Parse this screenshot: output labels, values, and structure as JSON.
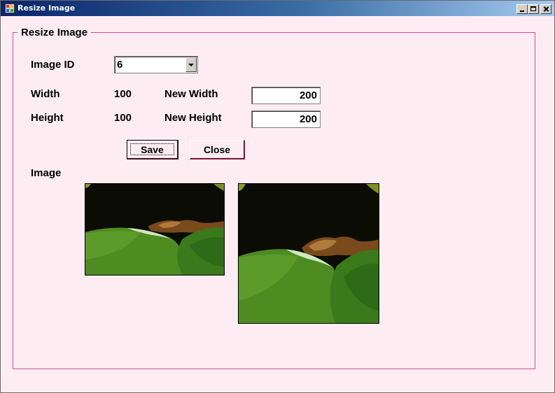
{
  "window": {
    "title": "Resize Image"
  },
  "group": {
    "title": "Resize Image"
  },
  "form": {
    "image_id_label": "Image ID",
    "image_id_value": "6",
    "width_label": "Width",
    "width_value": "100",
    "new_width_label": "New Width",
    "new_width_value": "200",
    "height_label": "Height",
    "height_value": "100",
    "new_height_label": "New Height",
    "new_height_value": "200",
    "image_label": "Image"
  },
  "buttons": {
    "save_label": "Save",
    "close_label": "Close"
  },
  "icons": {
    "app": "app-icon",
    "minimize": "minimize-icon",
    "maximize": "maximize-icon",
    "close": "close-icon",
    "dropdown": "chevron-down-icon"
  },
  "colors": {
    "background": "#fdedf3",
    "group_border": "#d04e93",
    "title_bar_start": "#0a246a",
    "title_bar_end": "#a6caf0",
    "button_border": "#7a1233"
  }
}
